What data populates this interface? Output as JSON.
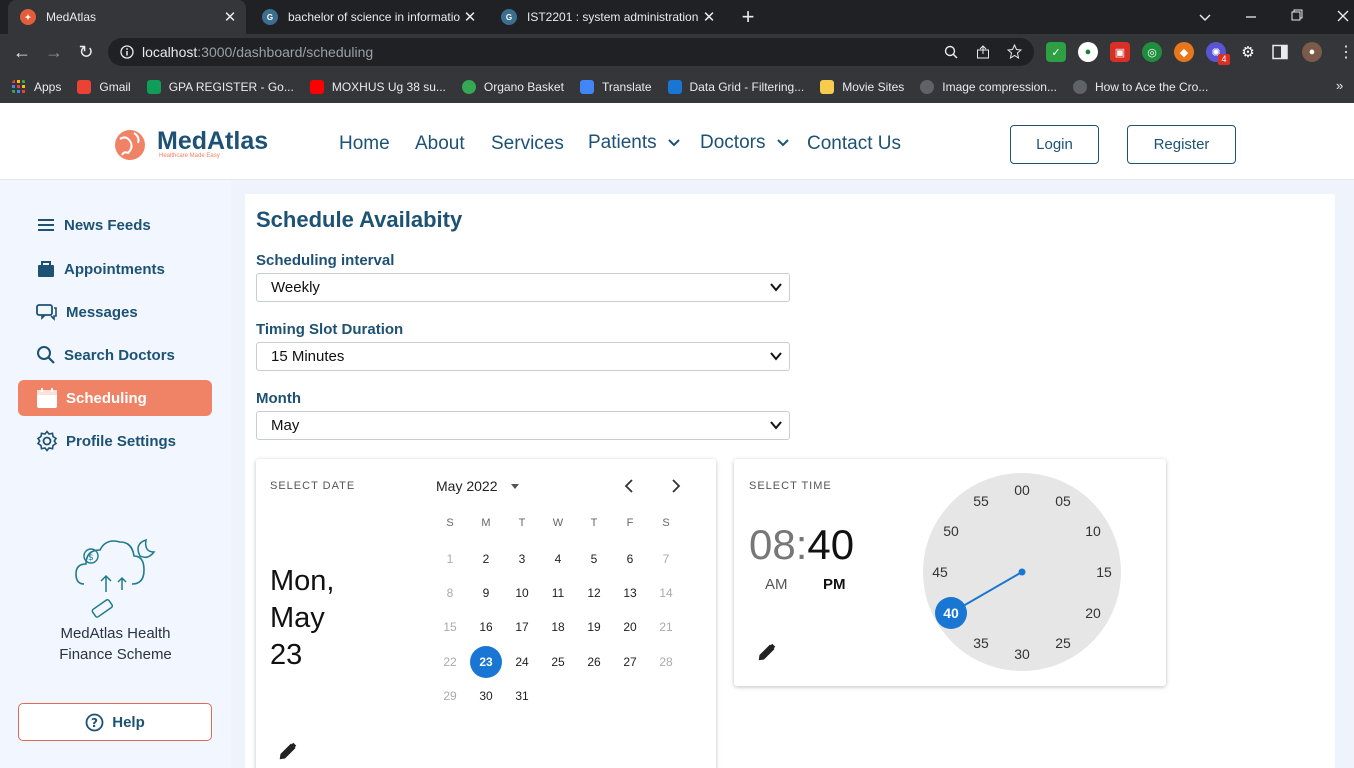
{
  "browser": {
    "tabs": [
      {
        "title": "MedAtlas",
        "active": true
      },
      {
        "title": "bachelor of science in informatio",
        "active": false
      },
      {
        "title": "IST2201 : system administration -",
        "active": false
      }
    ],
    "new_tab_symbol": "+",
    "url_host": "localhost",
    "url_path": ":3000/dashboard/scheduling",
    "extension_badge": "4",
    "bookmarks": [
      {
        "label": "Apps",
        "color": "#ea4335"
      },
      {
        "label": "Gmail",
        "color": "#ea4335"
      },
      {
        "label": "GPA REGISTER - Go...",
        "color": "#0f9d58"
      },
      {
        "label": "MOXHUS Ug 38 su...",
        "color": "#ff0000"
      },
      {
        "label": "Organo Basket",
        "color": "#34a853"
      },
      {
        "label": "Translate",
        "color": "#4285f4"
      },
      {
        "label": "Data Grid - Filtering...",
        "color": "#1976d2"
      },
      {
        "label": "Movie Sites",
        "color": "#f7cb4d"
      },
      {
        "label": "Image compression...",
        "color": "#5f6368"
      },
      {
        "label": "How to Ace the Cro...",
        "color": "#5f6368"
      }
    ]
  },
  "header": {
    "logo_text": "MedAtlas",
    "logo_tagline": "Healthcare Made Easy",
    "nav": {
      "home": "Home",
      "about": "About",
      "services": "Services",
      "patients": "Patients",
      "doctors": "Doctors",
      "contact": "Contact Us"
    },
    "login": "Login",
    "register": "Register"
  },
  "sidebar": {
    "items": [
      {
        "label": "News Feeds",
        "icon": "menu-icon"
      },
      {
        "label": "Appointments",
        "icon": "bag-icon"
      },
      {
        "label": "Messages",
        "icon": "messages-icon"
      },
      {
        "label": "Search Doctors",
        "icon": "search-icon"
      },
      {
        "label": "Scheduling",
        "icon": "calendar-icon",
        "active": true
      },
      {
        "label": "Profile Settings",
        "icon": "gear-icon"
      }
    ],
    "promo_line1": "MedAtlas Health",
    "promo_line2": "Finance Scheme",
    "help": "Help"
  },
  "main": {
    "title": "Schedule Availabity",
    "interval_label": "Scheduling interval",
    "interval_value": "Weekly",
    "slot_label": "Timing Slot Duration",
    "slot_value": "15 Minutes",
    "month_label": "Month",
    "month_value": "May",
    "date_picker": {
      "caption": "SELECT DATE",
      "day_line": "Mon,",
      "month_line": "May",
      "date_line": "23",
      "month_year": "May 2022",
      "weekdays": [
        "S",
        "M",
        "T",
        "W",
        "T",
        "F",
        "S"
      ],
      "weeks": [
        [
          "1",
          "2",
          "3",
          "4",
          "5",
          "6",
          "7"
        ],
        [
          "8",
          "9",
          "10",
          "11",
          "12",
          "13",
          "14"
        ],
        [
          "15",
          "16",
          "17",
          "18",
          "19",
          "20",
          "21"
        ],
        [
          "22",
          "23",
          "24",
          "25",
          "26",
          "27",
          "28"
        ],
        [
          "29",
          "30",
          "31",
          "",
          "",
          "",
          ""
        ]
      ],
      "selected": "23"
    },
    "time_picker": {
      "caption": "SELECT TIME",
      "hour": "08",
      "separator": ":",
      "minute": "40",
      "am": "AM",
      "pm": "PM",
      "clock_numbers": [
        "00",
        "05",
        "10",
        "15",
        "20",
        "25",
        "30",
        "35",
        "40",
        "45",
        "50",
        "55"
      ],
      "selected_minute": "40"
    }
  },
  "colors": {
    "brand": "#1d5274",
    "accent": "#f08366",
    "picker": "#1976d2"
  }
}
